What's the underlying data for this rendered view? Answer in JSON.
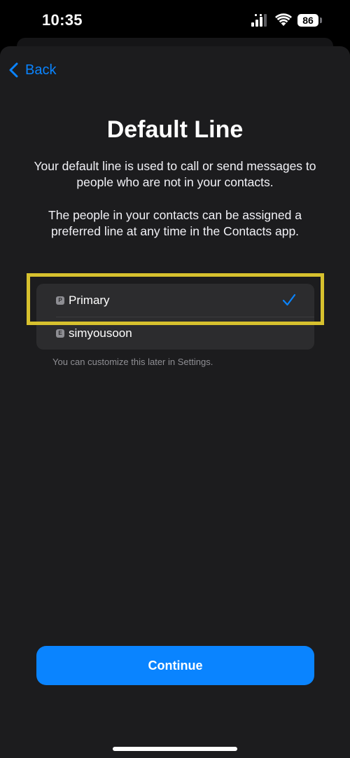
{
  "status_bar": {
    "time": "10:35",
    "battery_level": "86",
    "icons": [
      "signal-icon",
      "wifi-icon",
      "battery-icon"
    ]
  },
  "nav": {
    "back_label": "Back",
    "back_icon": "chevron-left-icon"
  },
  "page": {
    "title": "Default Line",
    "description_1": "Your default line is used to call or send messages to people who are not in your contacts.",
    "description_2": "The people in your contacts can be assigned a preferred line at any time in the Contacts app."
  },
  "lines": {
    "items": [
      {
        "badge": "P",
        "label": "Primary",
        "selected": true
      },
      {
        "badge": "E",
        "label": "simyousoon",
        "selected": false
      }
    ],
    "selected_icon": "checkmark-icon",
    "footnote": "You can customize this later in Settings."
  },
  "actions": {
    "continue_label": "Continue"
  },
  "colors": {
    "accent": "#0a84ff",
    "sheet_background": "#1c1c1e",
    "list_background": "#2c2c2e",
    "highlight": "#d7c12e",
    "secondary_text": "#8e8e93"
  }
}
